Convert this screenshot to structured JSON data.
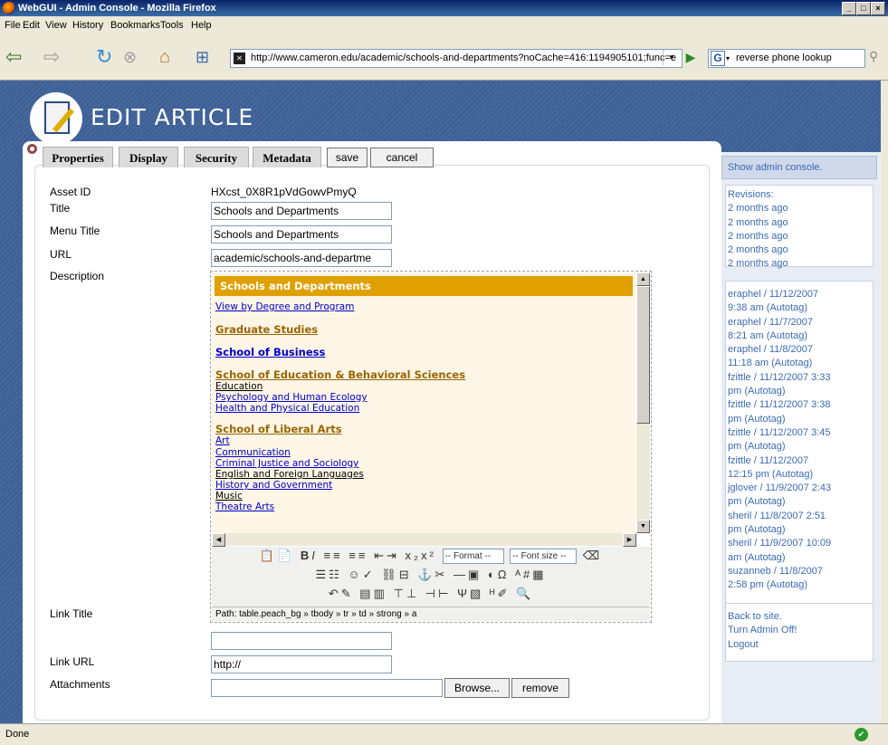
{
  "window": {
    "title": "WebGUI - Admin Console - Mozilla Firefox",
    "minimize": "_",
    "maximize": "□",
    "close": "×"
  },
  "menu": [
    "File",
    "Edit",
    "View",
    "History",
    "Bookmarks",
    "Tools",
    "Help"
  ],
  "nav": {
    "url": "http://www.cameron.edu/academic/schools-and-departments?noCache=416:1194905101;func=e",
    "search_value": "reverse phone lookup"
  },
  "header": {
    "title": "EDIT ARTICLE"
  },
  "tabs": [
    "Properties",
    "Display",
    "Security",
    "Metadata"
  ],
  "buttons": {
    "save": "save",
    "cancel": "cancel",
    "browse": "Browse...",
    "remove": "remove"
  },
  "form": {
    "asset_id_label": "Asset ID",
    "asset_id_value": "HXcst_0X8R1pVdGowvPmyQ",
    "title_label": "Title",
    "title_value": "Schools and Departments",
    "menu_title_label": "Menu Title",
    "menu_title_value": "Schools and Departments",
    "url_label": "URL",
    "url_value": "academic/schools-and-departme",
    "description_label": "Description",
    "link_title_label": "Link Title",
    "link_title_value": "",
    "link_url_label": "Link URL",
    "link_url_value": "http://",
    "attachments_label": "Attachments"
  },
  "editor": {
    "header": "Schools and Departments",
    "link_degree": "View by Degree and Program",
    "graduate": "Graduate Studies",
    "business": "School of Business",
    "education_school": "School of Education & Behavioral Sciences",
    "edu_items": [
      " Education",
      " Psychology and Human Ecology",
      " Health and Physical Education"
    ],
    "liberal_arts": "School of Liberal Arts",
    "la_items": [
      " Art",
      " Communication",
      " Criminal Justice and Sociology",
      " English and Foreign Languages",
      " History and Government",
      " Music",
      " Theatre Arts"
    ],
    "format_select": "-- Format --",
    "fontsize_select": "-- Font size --",
    "path": "Path: table.peach_bg » tbody » tr » td » strong » a"
  },
  "sidebar": {
    "show_console": "Show admin console.",
    "revisions_label": "Revisions:",
    "revisions": [
      "2 months ago",
      "2 months ago",
      "2 months ago",
      "2 months ago",
      "2 months ago"
    ],
    "history": [
      "eraphel / 11/12/2007",
      "9:38 am (Autotag)",
      "eraphel / 11/7/2007",
      "8:21 am (Autotag)",
      "eraphel / 11/8/2007",
      "11:18 am (Autotag)",
      "fzittle / 11/12/2007 3:33",
      "pm (Autotag)",
      "fzittle / 11/12/2007 3:38",
      "pm (Autotag)",
      "fzittle / 11/12/2007 3:45",
      "pm (Autotag)",
      "fzittle / 11/12/2007",
      "12:15 pm (Autotag)",
      "jglover / 11/9/2007 2:43",
      "pm (Autotag)",
      "sheril / 11/8/2007 2:51",
      "pm (Autotag)",
      "sheril / 11/9/2007 10:09",
      "am (Autotag)",
      "suzanneb / 11/8/2007",
      "2:58 pm (Autotag)"
    ],
    "links": [
      "Back to site.",
      "Turn Admin Off!",
      "Logout"
    ]
  },
  "status": {
    "text": "Done"
  }
}
